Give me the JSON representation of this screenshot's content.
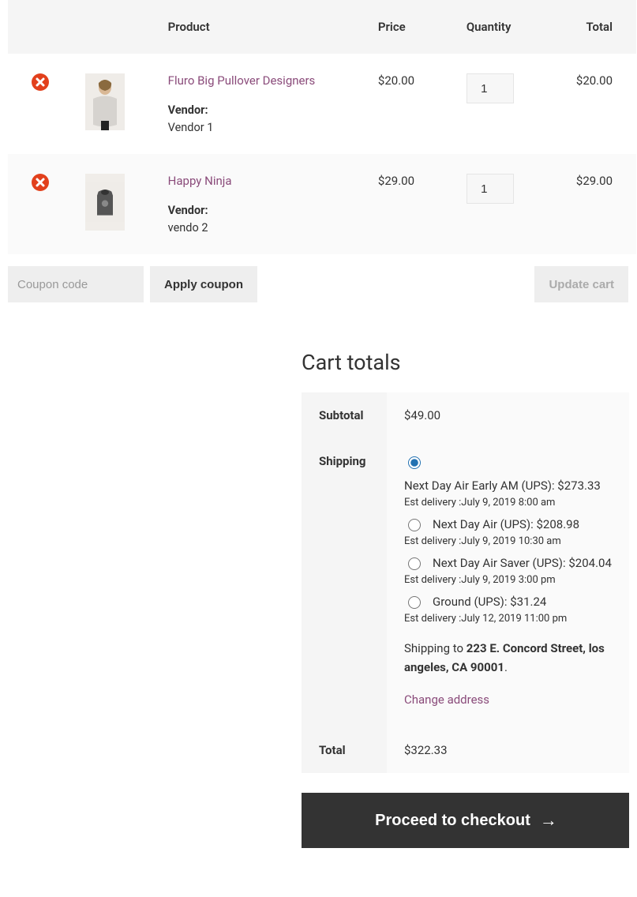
{
  "headers": {
    "product": "Product",
    "price": "Price",
    "quantity": "Quantity",
    "total": "Total"
  },
  "items": [
    {
      "name": "Fluro Big Pullover Designers",
      "price": "$20.00",
      "qty": "1",
      "total": "$20.00",
      "vendor_label": "Vendor:",
      "vendor_name": "Vendor 1",
      "thumb_type": "person"
    },
    {
      "name": "Happy Ninja",
      "price": "$29.00",
      "qty": "1",
      "total": "$29.00",
      "vendor_label": "Vendor:",
      "vendor_name": "vendo 2",
      "thumb_type": "hoodie"
    }
  ],
  "coupon": {
    "placeholder": "Coupon code",
    "apply": "Apply coupon",
    "update": "Update cart"
  },
  "totals": {
    "heading": "Cart totals",
    "subtotal_label": "Subtotal",
    "subtotal_value": "$49.00",
    "shipping_label": "Shipping",
    "shipping_options": [
      {
        "label": "Next Day Air Early AM (UPS): $273.33",
        "est": "Est delivery :July 9, 2019 8:00 am",
        "checked": true
      },
      {
        "label": "Next Day Air (UPS): $208.98",
        "est": "Est delivery :July 9, 2019 10:30 am",
        "checked": false
      },
      {
        "label": "Next Day Air Saver (UPS): $204.04",
        "est": "Est delivery :July 9, 2019 3:00 pm",
        "checked": false
      },
      {
        "label": "Ground (UPS): $31.24",
        "est": "Est delivery :July 12, 2019 11:00 pm",
        "checked": false
      }
    ],
    "ship_to_prefix": "Shipping to ",
    "ship_to_address": "223 E. Concord Street, los angeles, CA 90001",
    "ship_to_suffix": ".",
    "change_address": "Change address",
    "total_label": "Total",
    "total_value": "$322.33",
    "checkout": "Proceed to checkout"
  }
}
